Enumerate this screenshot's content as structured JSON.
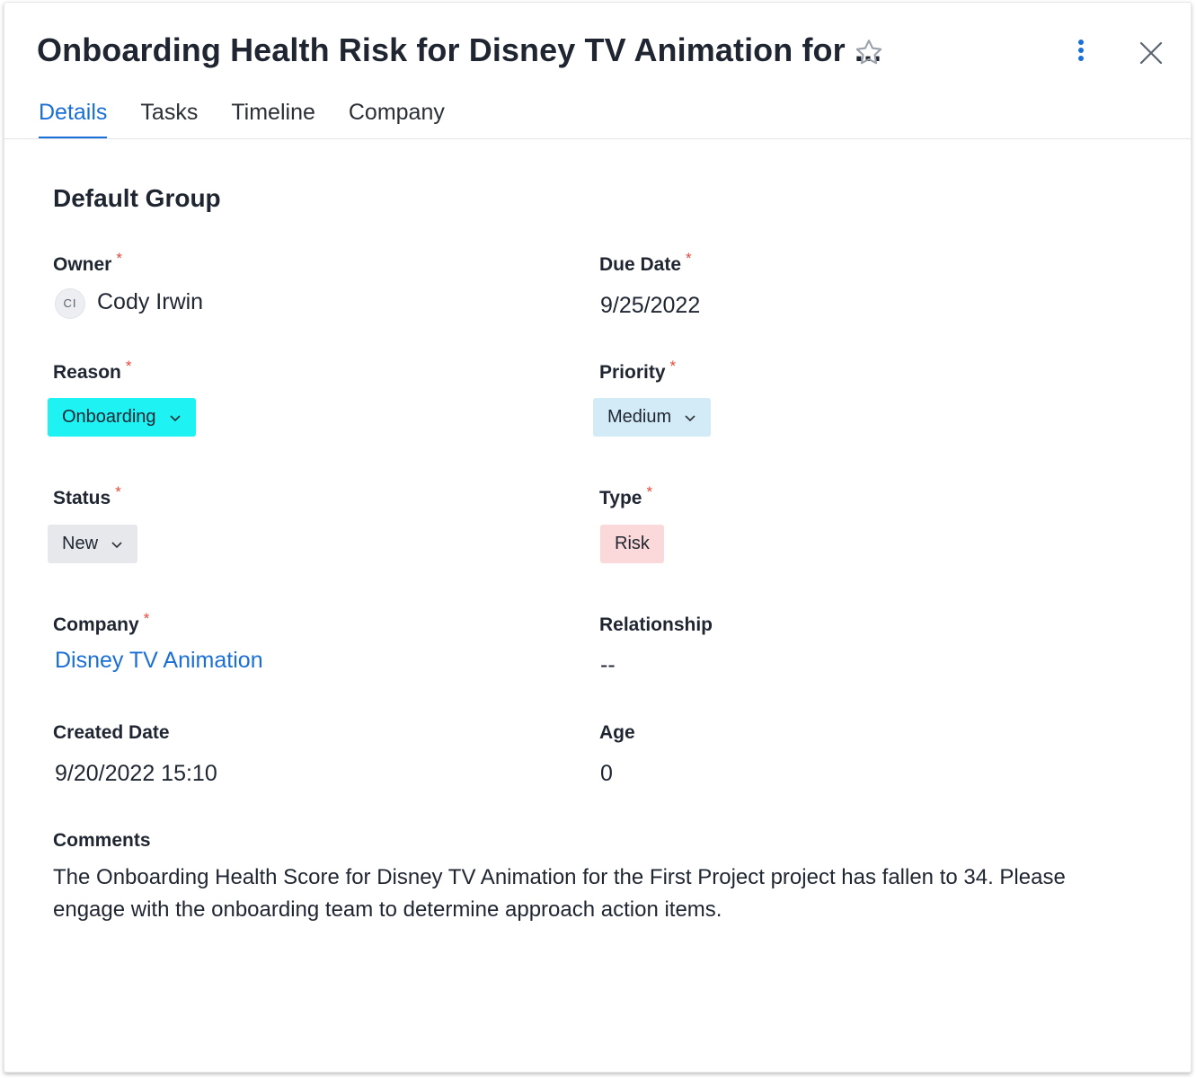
{
  "header": {
    "title": "Onboarding Health Risk for Disney TV Animation for ..."
  },
  "tabs": [
    {
      "label": "Details"
    },
    {
      "label": "Tasks"
    },
    {
      "label": "Timeline"
    },
    {
      "label": "Company"
    }
  ],
  "group_title": "Default Group",
  "required_mark": "*",
  "fields": {
    "owner": {
      "label": "Owner",
      "initials": "CI",
      "value": "Cody Irwin"
    },
    "due_date": {
      "label": "Due Date",
      "value": "9/25/2022"
    },
    "reason": {
      "label": "Reason",
      "value": "Onboarding",
      "color": "#1ef2f2"
    },
    "priority": {
      "label": "Priority",
      "value": "Medium",
      "color": "#d3ebf7"
    },
    "status": {
      "label": "Status",
      "value": "New",
      "color": "#e6e8eb"
    },
    "type": {
      "label": "Type",
      "value": "Risk",
      "color": "#fbd9da"
    },
    "company": {
      "label": "Company",
      "value": "Disney TV Animation"
    },
    "relationship": {
      "label": "Relationship",
      "value": "--"
    },
    "created_date": {
      "label": "Created Date",
      "value": "9/20/2022 15:10"
    },
    "age": {
      "label": "Age",
      "value": "0"
    },
    "comments": {
      "label": "Comments",
      "value": "The Onboarding Health Score for Disney TV Animation for the First Project project has fallen to 34. Please engage with the onboarding team to determine approach action items."
    }
  },
  "colors": {
    "accent": "#1a6fd6",
    "required": "#e5493a"
  },
  "icons": {
    "star": "star-icon",
    "more": "more-vertical-icon",
    "close": "close-icon",
    "chevron": "chevron-down-icon"
  }
}
